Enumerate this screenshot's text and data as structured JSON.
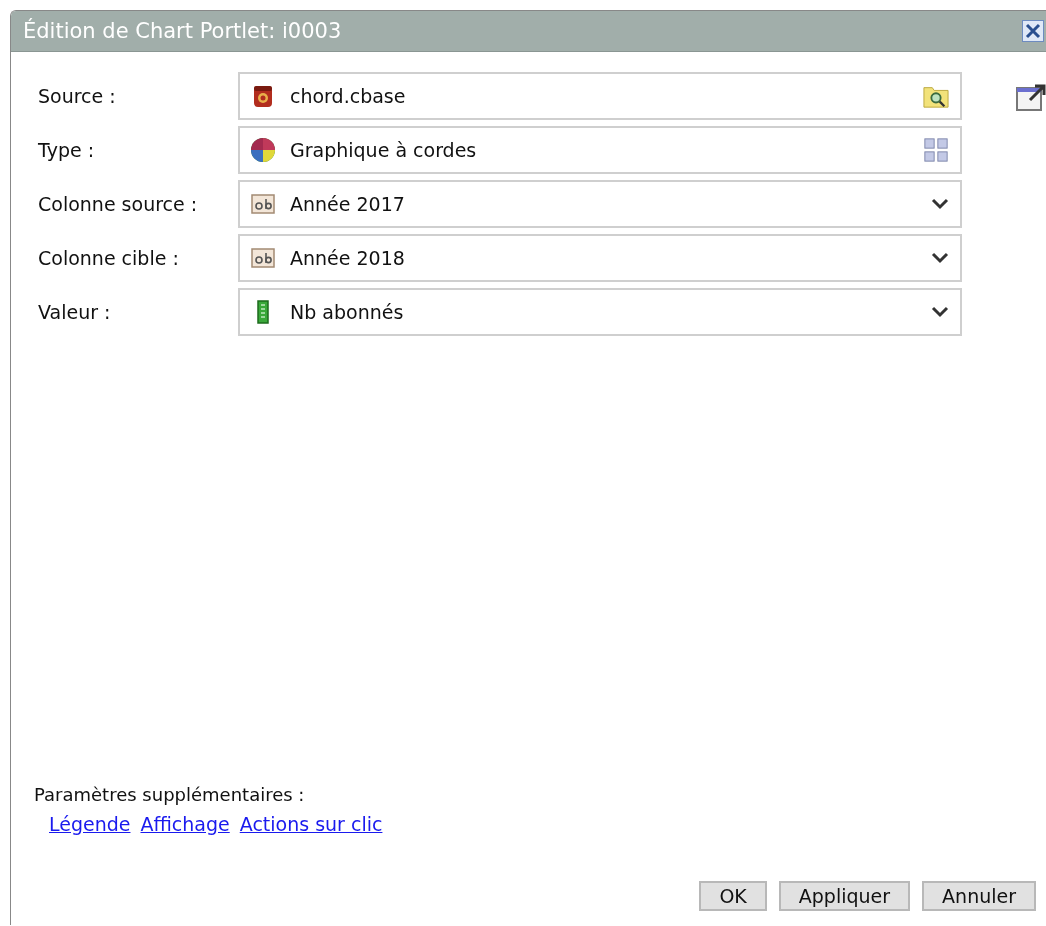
{
  "window": {
    "title": "Édition de Chart Portlet: i0003"
  },
  "fields": [
    {
      "label": "Source :",
      "value": "chord.cbase",
      "kind": "file"
    },
    {
      "label": "Type :",
      "value": "Graphique à cordes",
      "kind": "gallery"
    },
    {
      "label": "Colonne source :",
      "value": "Année 2017",
      "kind": "textcolumn"
    },
    {
      "label": "Colonne cible :",
      "value": "Année 2018",
      "kind": "textcolumn"
    },
    {
      "label": "Valeur :",
      "value": "Nb abonnés",
      "kind": "measure"
    }
  ],
  "extra": {
    "heading": "Paramètres supplémentaires :",
    "links": [
      "Légende",
      "Affichage",
      "Actions sur clic"
    ]
  },
  "buttons": [
    "OK",
    "Appliquer",
    "Annuler"
  ]
}
